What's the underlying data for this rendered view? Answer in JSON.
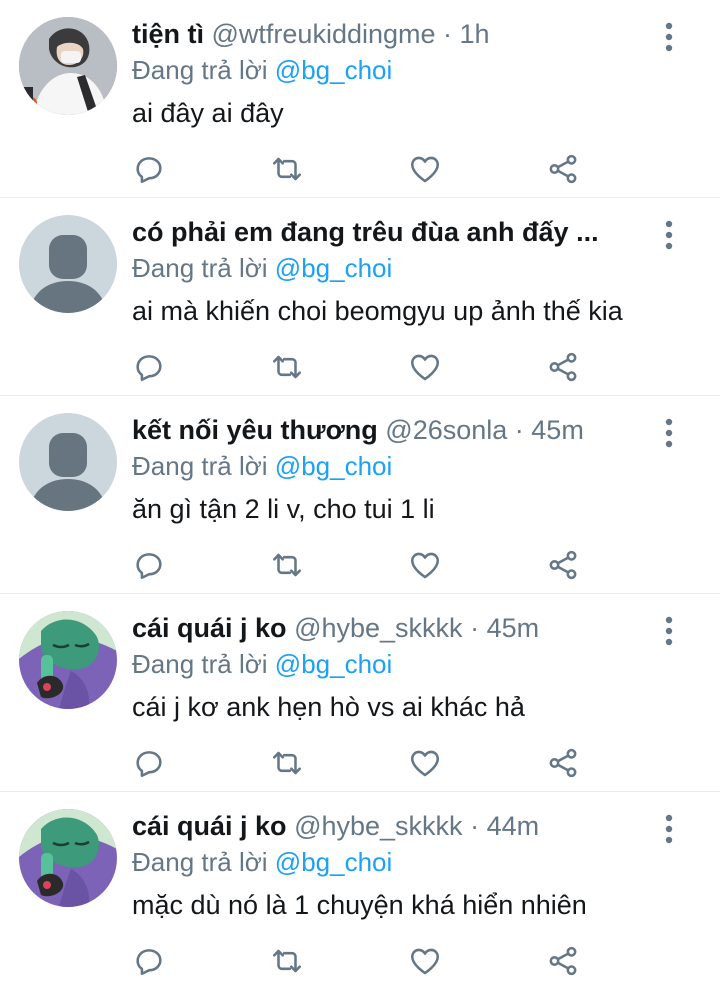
{
  "colors": {
    "text_primary": "#14171a",
    "text_secondary": "#657786",
    "link": "#1da1f2",
    "icon": "#657786",
    "divider": "#e6ecf0",
    "avatar_placeholder_bg": "#ccd6dd",
    "avatar_placeholder_fg": "#66757f"
  },
  "reply_prefix": "Đang trả lời",
  "actions": [
    "reply-icon",
    "retweet-icon",
    "like-icon",
    "share-icon"
  ],
  "tweets": [
    {
      "name": "tiện tì",
      "handle": "@wtfreukiddingme",
      "time": "1h",
      "reply_to": "@bg_choi",
      "text": "ai đây ai đây",
      "avatar": "photo"
    },
    {
      "name": "có phải em đang trêu đùa anh đấy ...",
      "handle": "",
      "time": "",
      "reply_to": "@bg_choi",
      "text": "ai mà khiến choi beomgyu up ảnh thế kia",
      "avatar": "default"
    },
    {
      "name": "kết nối yêu thương",
      "handle": "@26sonla",
      "time": "45m",
      "reply_to": "@bg_choi",
      "text": "ăn gì tận 2 li v, cho tui 1 li",
      "avatar": "default"
    },
    {
      "name": "cái quái j ko",
      "handle": "@hybe_skkkk",
      "time": "45m",
      "reply_to": "@bg_choi",
      "text": "cái j kơ ank hẹn hò vs ai khác hả",
      "avatar": "cartoon"
    },
    {
      "name": "cái quái j ko",
      "handle": "@hybe_skkkk",
      "time": "44m",
      "reply_to": "@bg_choi",
      "text": "mặc dù nó là 1 chuyện khá hiển nhiên",
      "avatar": "cartoon"
    }
  ]
}
